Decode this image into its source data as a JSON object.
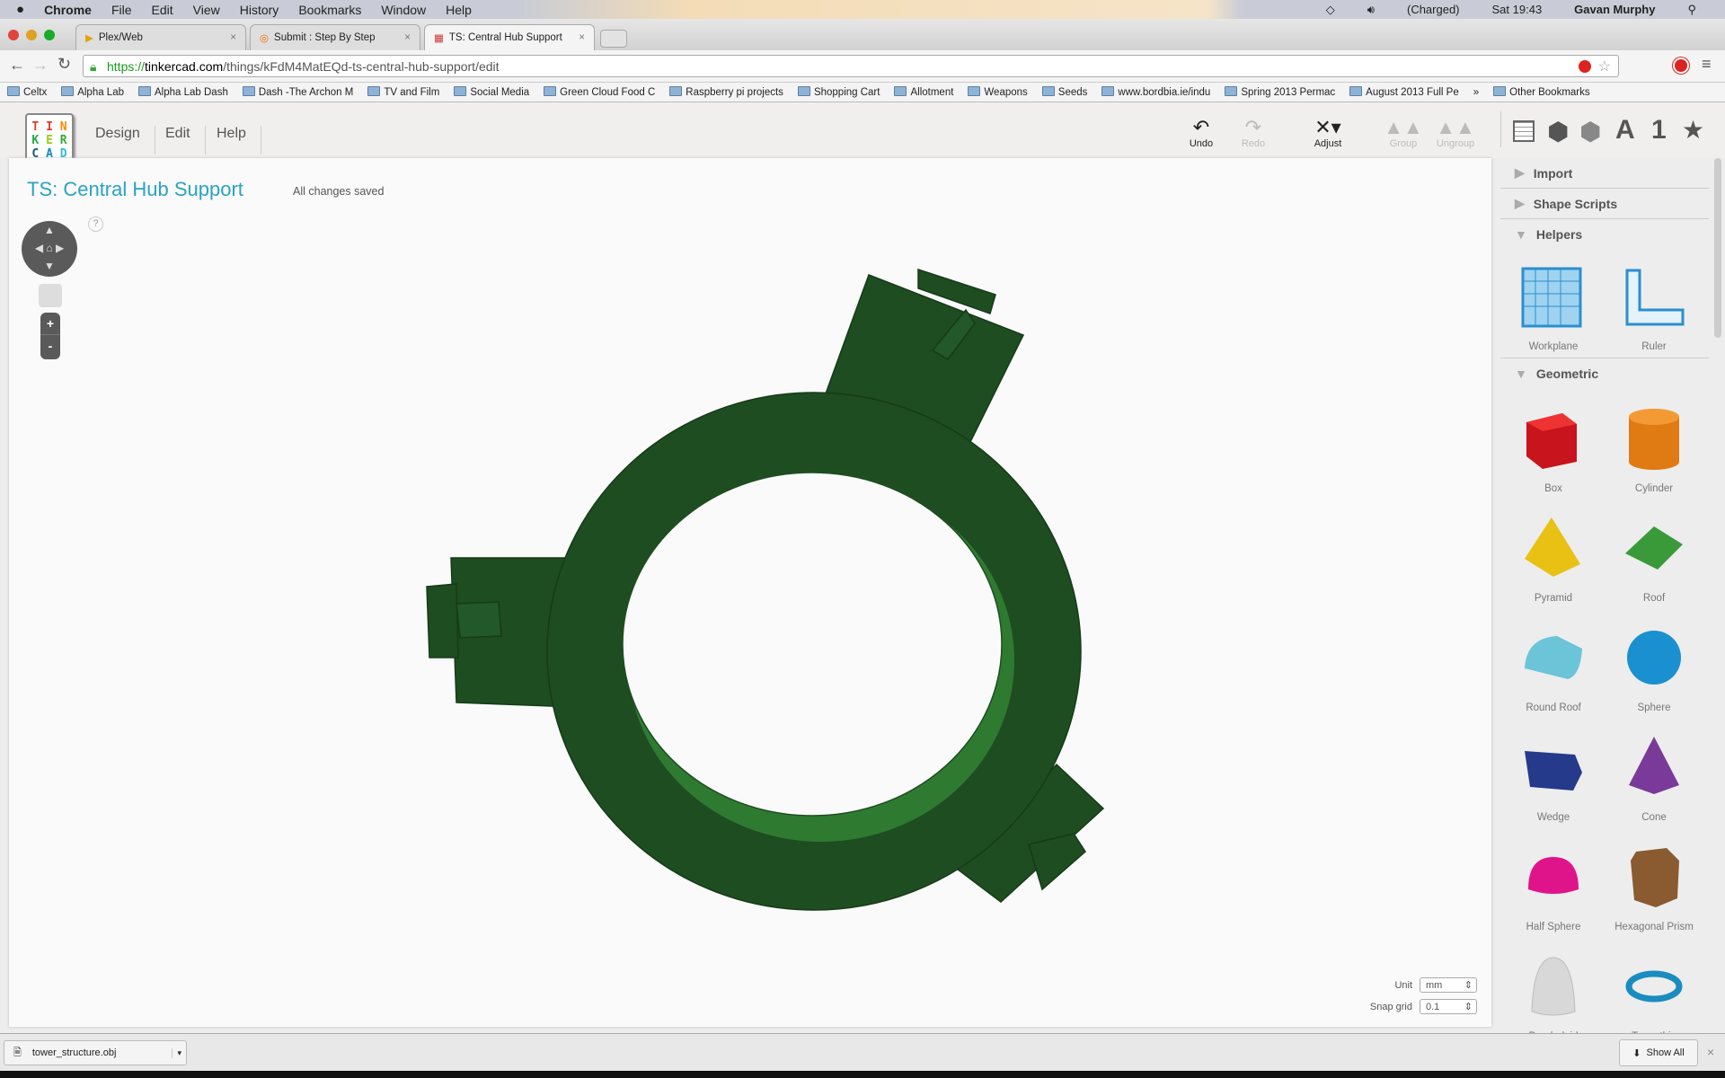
{
  "menubar": {
    "app": "Chrome",
    "items": [
      "File",
      "Edit",
      "View",
      "History",
      "Bookmarks",
      "Window",
      "Help"
    ],
    "battery": "(Charged)",
    "clock": "Sat 19:43",
    "user": "Gavan Murphy"
  },
  "tabs": [
    {
      "label": "Plex/Web"
    },
    {
      "label": "Submit : Step By Step"
    },
    {
      "label": "TS: Central Hub Support"
    }
  ],
  "address": {
    "scheme": "https://",
    "host": "tinkercad.com",
    "path": "/things/kFdM4MatEQd-ts-central-hub-support/edit"
  },
  "bookmarks": [
    "Celtx",
    "Alpha Lab",
    "Alpha Lab Dash",
    "Dash -The Archon M",
    "TV and Film",
    "Social Media",
    "Green Cloud Food C",
    "Raspberry pi projects",
    "Shopping Cart",
    "Allotment",
    "Weapons",
    "Seeds",
    "www.bordbia.ie/indu",
    "Spring 2013 Permac",
    "August 2013 Full Pe",
    "»",
    "Other Bookmarks"
  ],
  "tinkercad": {
    "logo": "TINKERCAD",
    "menu": [
      "Design",
      "Edit",
      "Help"
    ],
    "tools": {
      "undo": "Undo",
      "redo": "Redo",
      "adjust": "Adjust",
      "group": "Group",
      "ungroup": "Ungroup"
    },
    "view_icons": [
      "workplane-grid-icon",
      "box-icon",
      "hole-icon",
      "text-icon",
      "number-icon",
      "favorite-icon"
    ],
    "view_glyphs": {
      "text": "A",
      "number": "1",
      "star": "★"
    }
  },
  "design": {
    "title": "TS: Central Hub Support",
    "status": "All changes saved",
    "help": "?",
    "zoom_in": "+",
    "zoom_out": "-",
    "model_color": "#1e4d21"
  },
  "sidebar": {
    "sections": {
      "import": "Import",
      "scripts": "Shape Scripts",
      "helpers": "Helpers",
      "geometric": "Geometric"
    },
    "helpers": [
      "Workplane",
      "Ruler"
    ],
    "shapes": [
      "Box",
      "Cylinder",
      "Pyramid",
      "Roof",
      "Round Roof",
      "Sphere",
      "Wedge",
      "Cone",
      "Half Sphere",
      "Hexagonal Prism",
      "Paraboloid",
      "Torus thin"
    ]
  },
  "settings": {
    "unit_label": "Unit",
    "unit": "mm",
    "snap_label": "Snap grid",
    "snap": "0.1"
  },
  "download": {
    "file": "tower_structure.obj",
    "show_all": "Show All",
    "close": "×"
  }
}
